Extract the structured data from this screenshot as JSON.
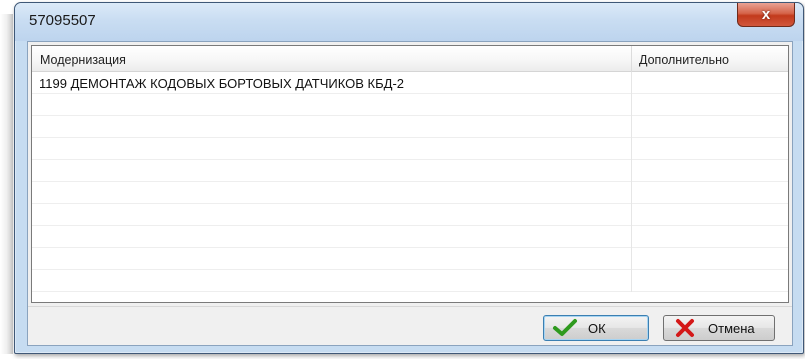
{
  "window": {
    "title": "57095507",
    "close_symbol": "x"
  },
  "grid": {
    "columns": [
      "Модернизация",
      "Дополнительно"
    ],
    "rows": [
      {
        "modernization": "1199 ДЕМОНТАЖ КОДОВЫХ БОРТОВЫХ ДАТЧИКОВ КБД-2",
        "additional": ""
      },
      {
        "modernization": "",
        "additional": ""
      },
      {
        "modernization": "",
        "additional": ""
      },
      {
        "modernization": "",
        "additional": ""
      },
      {
        "modernization": "",
        "additional": ""
      },
      {
        "modernization": "",
        "additional": ""
      },
      {
        "modernization": "",
        "additional": ""
      },
      {
        "modernization": "",
        "additional": ""
      },
      {
        "modernization": "",
        "additional": ""
      },
      {
        "modernization": "",
        "additional": ""
      }
    ]
  },
  "buttons": {
    "ok_label": "ОК",
    "ok_icon": "checkmark-icon",
    "cancel_label": "Отмена",
    "cancel_icon": "cross-icon"
  },
  "colors": {
    "ok_icon": "#2e9a1e",
    "cancel_icon": "#d41818",
    "titlebar": "#c6dcf1",
    "close_button": "#c8432a"
  }
}
